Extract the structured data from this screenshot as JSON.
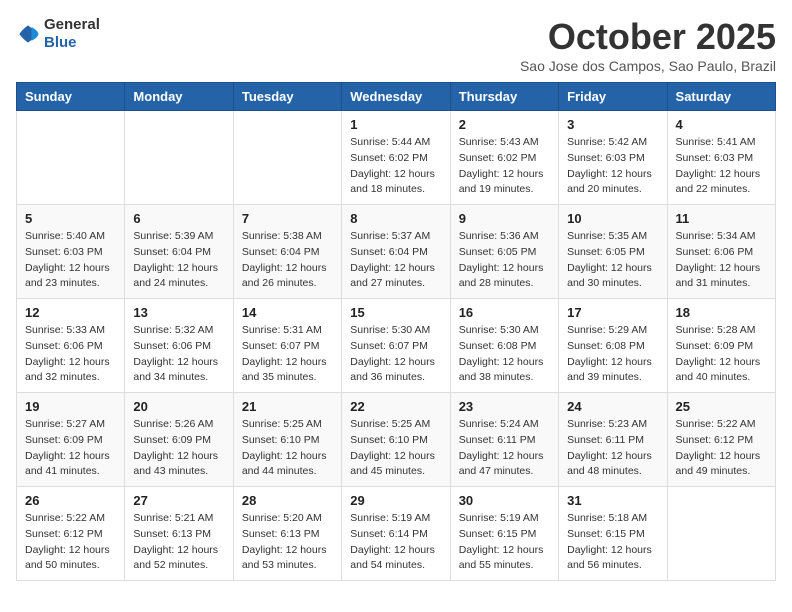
{
  "logo": {
    "text_general": "General",
    "text_blue": "Blue"
  },
  "title": {
    "month_year": "October 2025",
    "location": "Sao Jose dos Campos, Sao Paulo, Brazil"
  },
  "headers": [
    "Sunday",
    "Monday",
    "Tuesday",
    "Wednesday",
    "Thursday",
    "Friday",
    "Saturday"
  ],
  "weeks": [
    [
      {
        "day": "",
        "sunrise": "",
        "sunset": "",
        "daylight": ""
      },
      {
        "day": "",
        "sunrise": "",
        "sunset": "",
        "daylight": ""
      },
      {
        "day": "",
        "sunrise": "",
        "sunset": "",
        "daylight": ""
      },
      {
        "day": "1",
        "sunrise": "Sunrise: 5:44 AM",
        "sunset": "Sunset: 6:02 PM",
        "daylight": "Daylight: 12 hours and 18 minutes."
      },
      {
        "day": "2",
        "sunrise": "Sunrise: 5:43 AM",
        "sunset": "Sunset: 6:02 PM",
        "daylight": "Daylight: 12 hours and 19 minutes."
      },
      {
        "day": "3",
        "sunrise": "Sunrise: 5:42 AM",
        "sunset": "Sunset: 6:03 PM",
        "daylight": "Daylight: 12 hours and 20 minutes."
      },
      {
        "day": "4",
        "sunrise": "Sunrise: 5:41 AM",
        "sunset": "Sunset: 6:03 PM",
        "daylight": "Daylight: 12 hours and 22 minutes."
      }
    ],
    [
      {
        "day": "5",
        "sunrise": "Sunrise: 5:40 AM",
        "sunset": "Sunset: 6:03 PM",
        "daylight": "Daylight: 12 hours and 23 minutes."
      },
      {
        "day": "6",
        "sunrise": "Sunrise: 5:39 AM",
        "sunset": "Sunset: 6:04 PM",
        "daylight": "Daylight: 12 hours and 24 minutes."
      },
      {
        "day": "7",
        "sunrise": "Sunrise: 5:38 AM",
        "sunset": "Sunset: 6:04 PM",
        "daylight": "Daylight: 12 hours and 26 minutes."
      },
      {
        "day": "8",
        "sunrise": "Sunrise: 5:37 AM",
        "sunset": "Sunset: 6:04 PM",
        "daylight": "Daylight: 12 hours and 27 minutes."
      },
      {
        "day": "9",
        "sunrise": "Sunrise: 5:36 AM",
        "sunset": "Sunset: 6:05 PM",
        "daylight": "Daylight: 12 hours and 28 minutes."
      },
      {
        "day": "10",
        "sunrise": "Sunrise: 5:35 AM",
        "sunset": "Sunset: 6:05 PM",
        "daylight": "Daylight: 12 hours and 30 minutes."
      },
      {
        "day": "11",
        "sunrise": "Sunrise: 5:34 AM",
        "sunset": "Sunset: 6:06 PM",
        "daylight": "Daylight: 12 hours and 31 minutes."
      }
    ],
    [
      {
        "day": "12",
        "sunrise": "Sunrise: 5:33 AM",
        "sunset": "Sunset: 6:06 PM",
        "daylight": "Daylight: 12 hours and 32 minutes."
      },
      {
        "day": "13",
        "sunrise": "Sunrise: 5:32 AM",
        "sunset": "Sunset: 6:06 PM",
        "daylight": "Daylight: 12 hours and 34 minutes."
      },
      {
        "day": "14",
        "sunrise": "Sunrise: 5:31 AM",
        "sunset": "Sunset: 6:07 PM",
        "daylight": "Daylight: 12 hours and 35 minutes."
      },
      {
        "day": "15",
        "sunrise": "Sunrise: 5:30 AM",
        "sunset": "Sunset: 6:07 PM",
        "daylight": "Daylight: 12 hours and 36 minutes."
      },
      {
        "day": "16",
        "sunrise": "Sunrise: 5:30 AM",
        "sunset": "Sunset: 6:08 PM",
        "daylight": "Daylight: 12 hours and 38 minutes."
      },
      {
        "day": "17",
        "sunrise": "Sunrise: 5:29 AM",
        "sunset": "Sunset: 6:08 PM",
        "daylight": "Daylight: 12 hours and 39 minutes."
      },
      {
        "day": "18",
        "sunrise": "Sunrise: 5:28 AM",
        "sunset": "Sunset: 6:09 PM",
        "daylight": "Daylight: 12 hours and 40 minutes."
      }
    ],
    [
      {
        "day": "19",
        "sunrise": "Sunrise: 5:27 AM",
        "sunset": "Sunset: 6:09 PM",
        "daylight": "Daylight: 12 hours and 41 minutes."
      },
      {
        "day": "20",
        "sunrise": "Sunrise: 5:26 AM",
        "sunset": "Sunset: 6:09 PM",
        "daylight": "Daylight: 12 hours and 43 minutes."
      },
      {
        "day": "21",
        "sunrise": "Sunrise: 5:25 AM",
        "sunset": "Sunset: 6:10 PM",
        "daylight": "Daylight: 12 hours and 44 minutes."
      },
      {
        "day": "22",
        "sunrise": "Sunrise: 5:25 AM",
        "sunset": "Sunset: 6:10 PM",
        "daylight": "Daylight: 12 hours and 45 minutes."
      },
      {
        "day": "23",
        "sunrise": "Sunrise: 5:24 AM",
        "sunset": "Sunset: 6:11 PM",
        "daylight": "Daylight: 12 hours and 47 minutes."
      },
      {
        "day": "24",
        "sunrise": "Sunrise: 5:23 AM",
        "sunset": "Sunset: 6:11 PM",
        "daylight": "Daylight: 12 hours and 48 minutes."
      },
      {
        "day": "25",
        "sunrise": "Sunrise: 5:22 AM",
        "sunset": "Sunset: 6:12 PM",
        "daylight": "Daylight: 12 hours and 49 minutes."
      }
    ],
    [
      {
        "day": "26",
        "sunrise": "Sunrise: 5:22 AM",
        "sunset": "Sunset: 6:12 PM",
        "daylight": "Daylight: 12 hours and 50 minutes."
      },
      {
        "day": "27",
        "sunrise": "Sunrise: 5:21 AM",
        "sunset": "Sunset: 6:13 PM",
        "daylight": "Daylight: 12 hours and 52 minutes."
      },
      {
        "day": "28",
        "sunrise": "Sunrise: 5:20 AM",
        "sunset": "Sunset: 6:13 PM",
        "daylight": "Daylight: 12 hours and 53 minutes."
      },
      {
        "day": "29",
        "sunrise": "Sunrise: 5:19 AM",
        "sunset": "Sunset: 6:14 PM",
        "daylight": "Daylight: 12 hours and 54 minutes."
      },
      {
        "day": "30",
        "sunrise": "Sunrise: 5:19 AM",
        "sunset": "Sunset: 6:15 PM",
        "daylight": "Daylight: 12 hours and 55 minutes."
      },
      {
        "day": "31",
        "sunrise": "Sunrise: 5:18 AM",
        "sunset": "Sunset: 6:15 PM",
        "daylight": "Daylight: 12 hours and 56 minutes."
      },
      {
        "day": "",
        "sunrise": "",
        "sunset": "",
        "daylight": ""
      }
    ]
  ]
}
